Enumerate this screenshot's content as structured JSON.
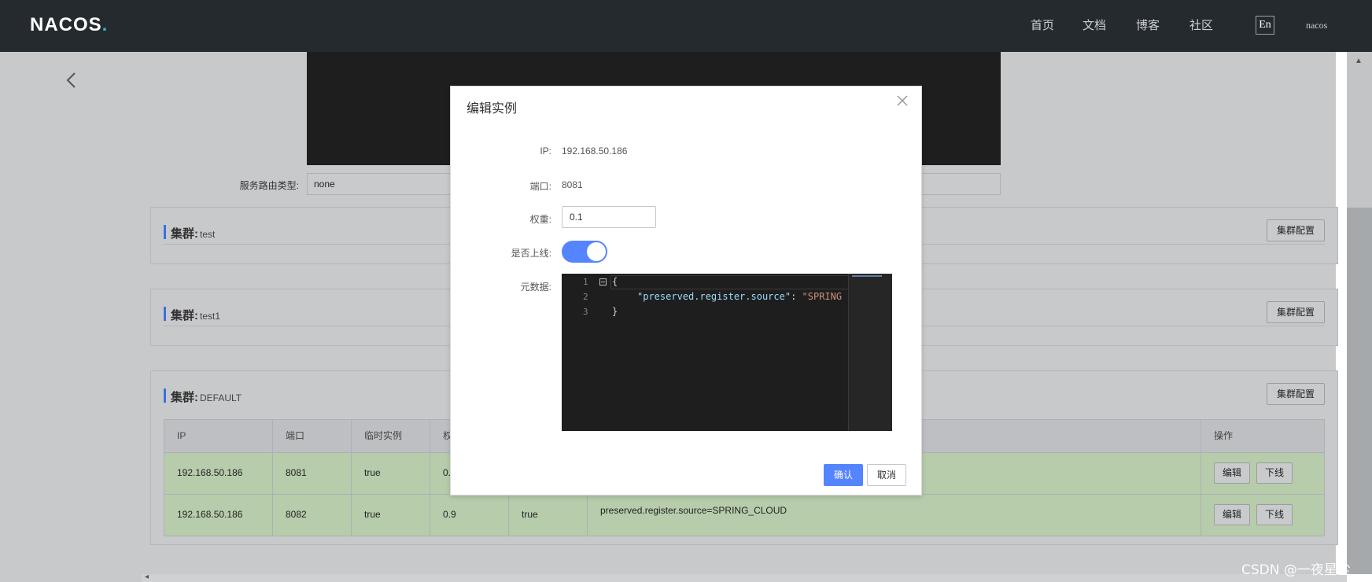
{
  "header": {
    "logo": "NACOS",
    "nav": [
      "首页",
      "文档",
      "博客",
      "社区"
    ],
    "lang": "En",
    "user": "nacos"
  },
  "service": {
    "route_type_label": "服务路由类型:",
    "route_type_value": "none"
  },
  "clusters": [
    {
      "label": "集群:",
      "name": "test",
      "config_button": "集群配置"
    },
    {
      "label": "集群:",
      "name": "test1",
      "config_button": "集群配置"
    },
    {
      "label": "集群:",
      "name": "DEFAULT",
      "config_button": "集群配置"
    }
  ],
  "instance_table": {
    "headers": [
      "IP",
      "端口",
      "临时实例",
      "权",
      "操作"
    ],
    "rows": [
      {
        "ip": "192.168.50.186",
        "port": "8081",
        "ephemeral": "true",
        "weight": "0.",
        "healthy": "",
        "metadata": ""
      },
      {
        "ip": "192.168.50.186",
        "port": "8082",
        "ephemeral": "true",
        "weight": "0.9",
        "healthy": "true",
        "metadata": "preserved.register.source=SPRING_CLOUD"
      }
    ],
    "edit_button": "编辑",
    "offline_button": "下线"
  },
  "dialog": {
    "title": "编辑实例",
    "ip_label": "IP:",
    "ip_value": "192.168.50.186",
    "port_label": "端口:",
    "port_value": "8081",
    "weight_label": "权重:",
    "weight_value": "0.1",
    "online_label": "是否上线:",
    "online_enabled": true,
    "metadata_label": "元数据:",
    "editor": {
      "line_numbers": [
        "1",
        "2",
        "3"
      ],
      "line1": "{",
      "line2_key": "\"preserved.register.source\"",
      "line2_colon": ": ",
      "line2_value": "\"SPRING",
      "line3": "}"
    },
    "ok_button": "确认",
    "cancel_button": "取消"
  },
  "watermark": "CSDN @一夜星尘",
  "colors": {
    "header_bg": "#252a2f",
    "primary": "#5584ff",
    "cluster_accent": "#3c6ee6",
    "row_bg": "#b6ccab"
  }
}
